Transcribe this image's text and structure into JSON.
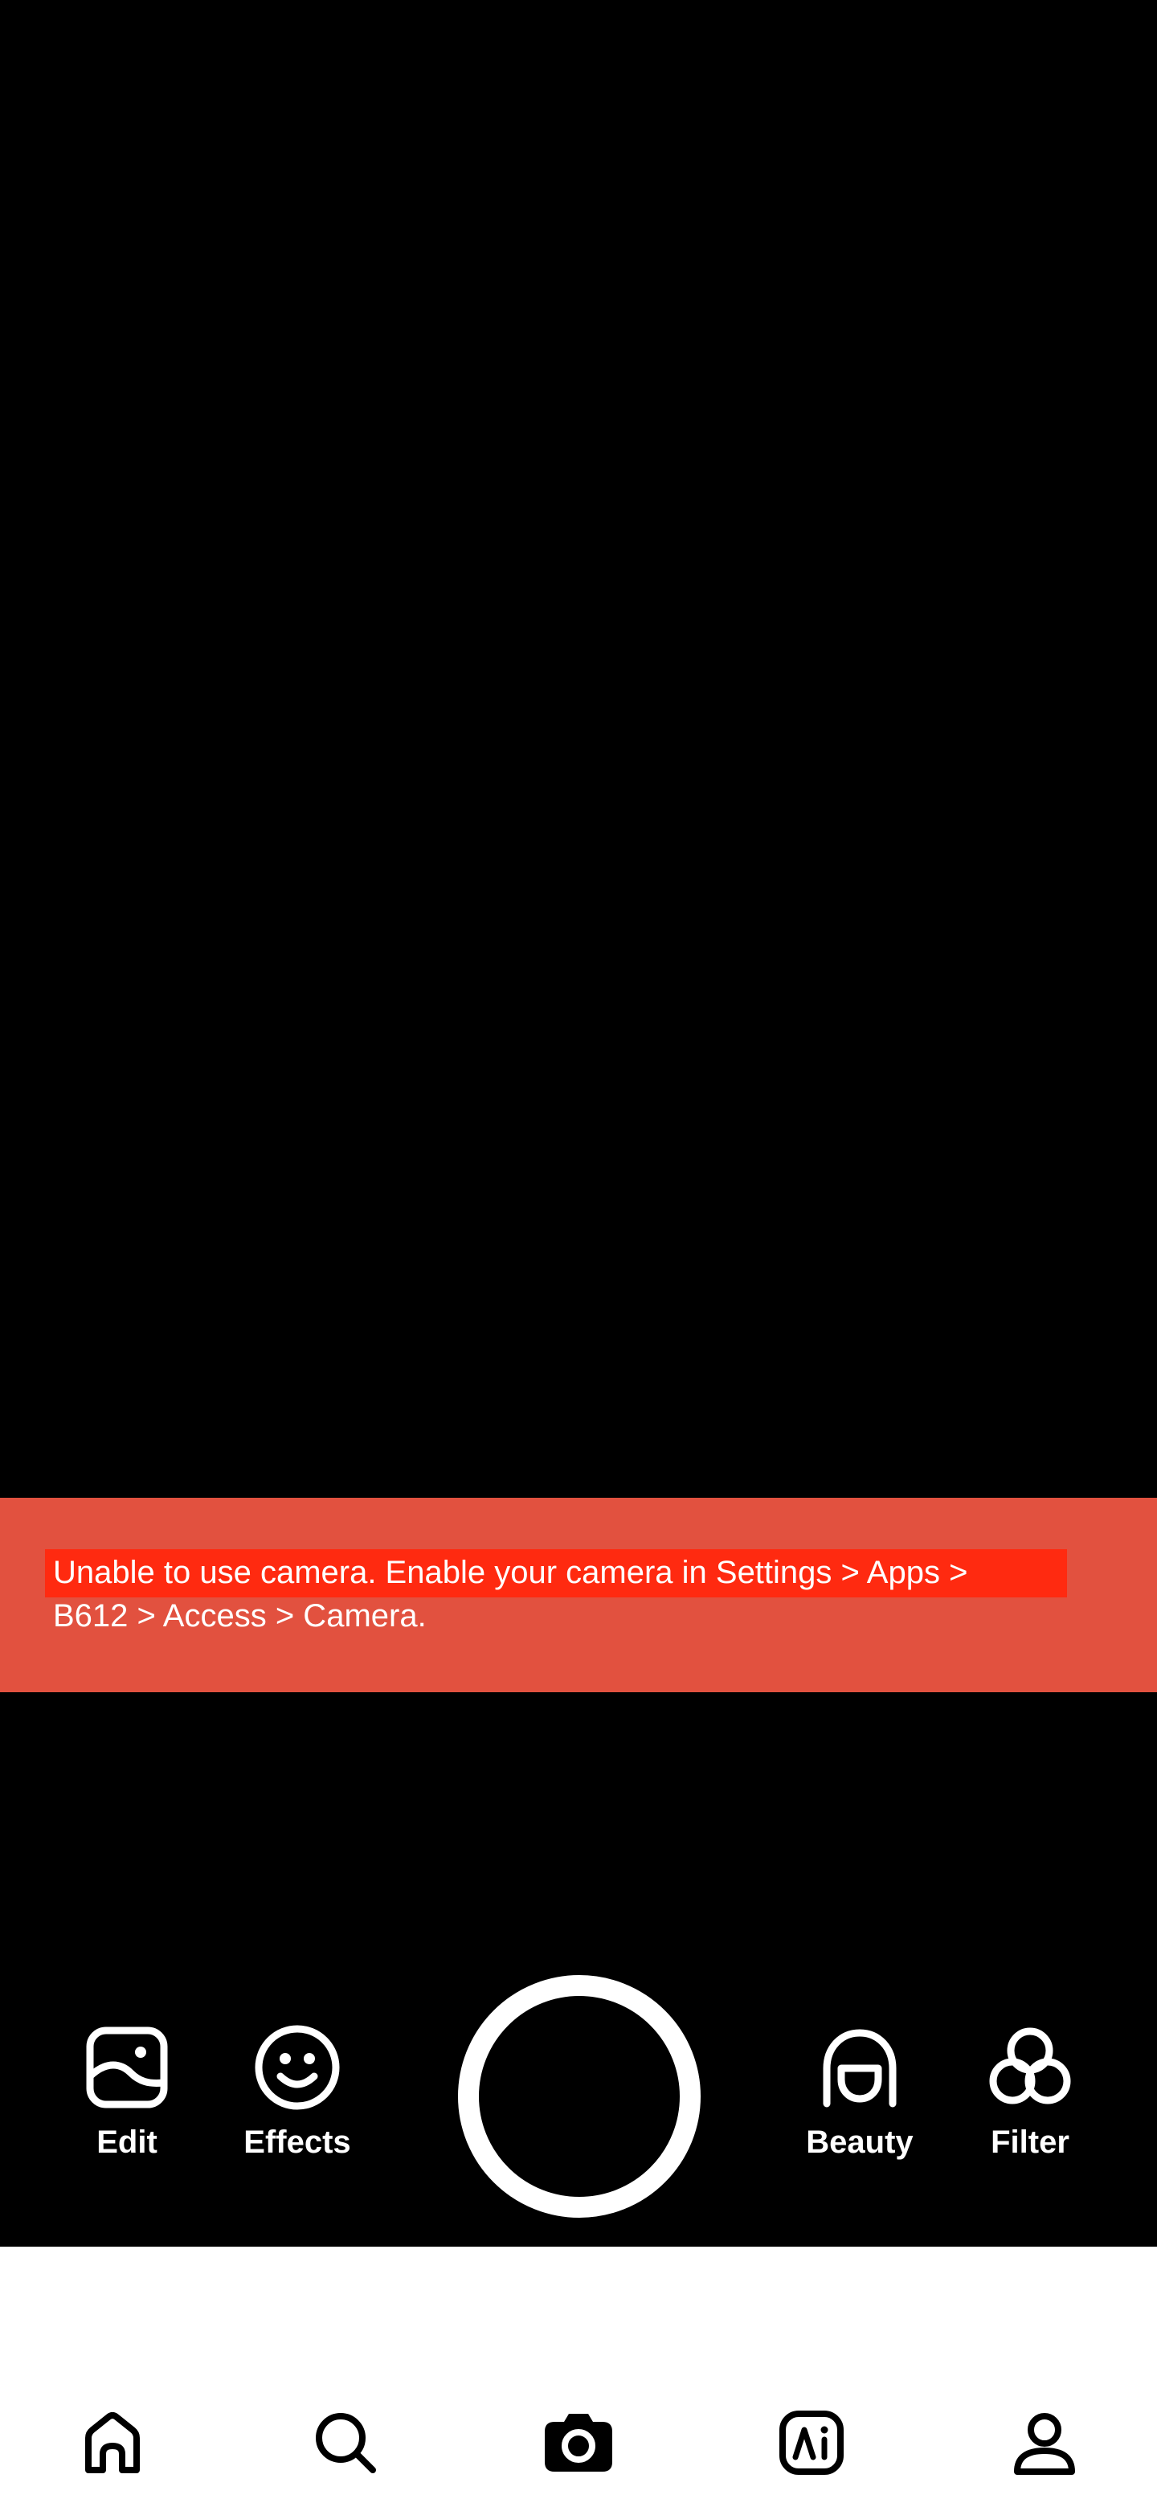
{
  "camera": {
    "error_message_line1": "Unable to use camera. Enable your camera in Settings > Apps >",
    "error_message_line2": "B612 > Access > Camera."
  },
  "tools": {
    "edit_label": "Edit",
    "effects_label": "Effects",
    "beauty_label": "Beauty",
    "filter_label": "Filter"
  },
  "bottom_nav": {
    "items": [
      {
        "icon": "home-icon"
      },
      {
        "icon": "search-icon"
      },
      {
        "icon": "camera-icon"
      },
      {
        "icon": "ai-icon"
      },
      {
        "icon": "profile-icon"
      }
    ]
  },
  "colors": {
    "background": "#000000",
    "error_banner": "#E2513F",
    "error_highlight": "#FF2A10",
    "nav_background": "#FFFFFF",
    "icon_light": "#FFFFFF",
    "icon_dark": "#000000"
  }
}
